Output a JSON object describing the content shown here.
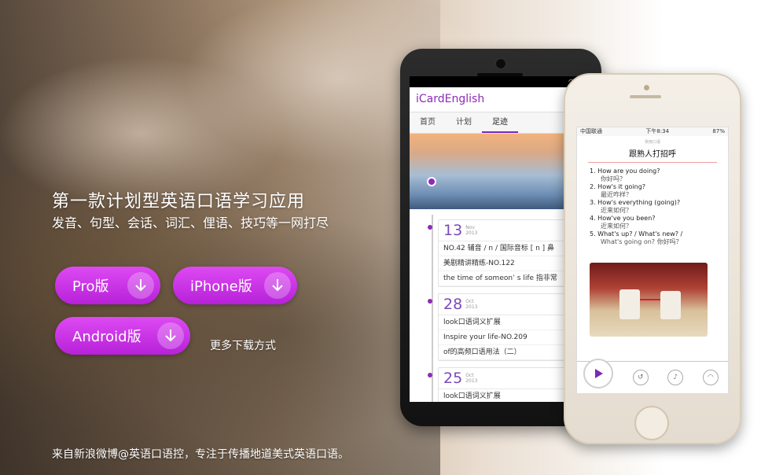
{
  "hero": {
    "headline": "第一款计划型英语口语学习应用",
    "subline": "发音、句型、会话、词汇、俚语、技巧等一网打尽"
  },
  "downloads": {
    "pro_label": "Pro版",
    "iphone_label": "iPhone版",
    "android_label": "Android版",
    "more_label": "更多下载方式"
  },
  "footer": {
    "text": "来自新浪微博@英语口语控，专注于传播地道美式英语口语。"
  },
  "colors": {
    "accent": "#c02ee0",
    "app_purple": "#8d2bb7"
  },
  "android_app": {
    "title": "iCardEnglish",
    "tabs": [
      "首页",
      "计划",
      "足迹"
    ],
    "active_tab": "足迹",
    "entries": [
      {
        "day": "13",
        "month": "Nov",
        "year": "2013",
        "lines": [
          "NO.42 辅音 / n / 国际音标 [ n ]  鼻",
          "美剧精讲精练-NO.122",
          "the time of someon’ s life 指非常"
        ]
      },
      {
        "day": "28",
        "month": "Oct",
        "year": "2013",
        "lines": [
          "look口语词义扩展",
          "Inspire your life-NO.209",
          "of的高频口语用法（二）"
        ]
      },
      {
        "day": "25",
        "month": "Oct",
        "year": "2013",
        "lines": [
          "look口语词义扩展"
        ]
      }
    ]
  },
  "iphone_app": {
    "status_carrier": "中国联通",
    "status_time": "下午8:34",
    "status_battery": "87%",
    "small_header": "常用口语",
    "title": "跟熟人打招呼",
    "items": [
      {
        "en": "1. How are you doing?",
        "zh": "你好吗？"
      },
      {
        "en": "2. How's it going?",
        "zh": "最近咋样？"
      },
      {
        "en": "3. How's everything (going)?",
        "zh": "近来如何？"
      },
      {
        "en": "4. How've you been?",
        "zh": "近来如何？"
      },
      {
        "en": "5. What's up? / What's new? /",
        "zh": "What's going on? 你好吗？"
      }
    ]
  }
}
